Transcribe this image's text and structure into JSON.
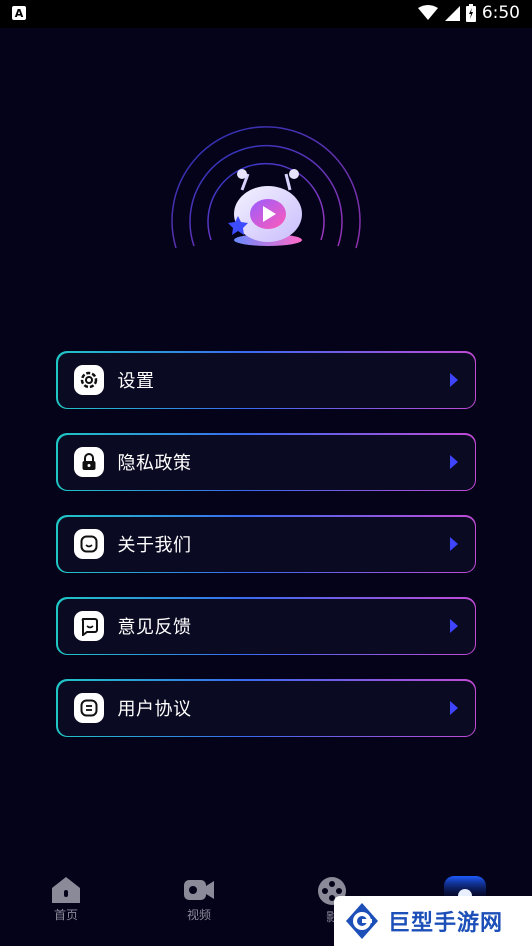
{
  "status_bar": {
    "notification_badge": "A",
    "time": "6:50"
  },
  "hero": {
    "icon": "robot-mascot-play-icon"
  },
  "menu": {
    "items": [
      {
        "label": "设置",
        "icon": "gear-icon"
      },
      {
        "label": "隐私政策",
        "icon": "lock-icon"
      },
      {
        "label": "关于我们",
        "icon": "smile-icon"
      },
      {
        "label": "意见反馈",
        "icon": "chat-smile-icon"
      },
      {
        "label": "用户协议",
        "icon": "document-icon"
      }
    ],
    "arrow_color": "#3f44ff"
  },
  "tab_bar": {
    "tabs": [
      {
        "label": "首页",
        "icon": "home-icon"
      },
      {
        "label": "视频",
        "icon": "video-camera-icon"
      },
      {
        "label": "影",
        "icon": "film-reel-icon"
      },
      {
        "label": "",
        "icon": "profile-icon-active"
      }
    ]
  },
  "watermark": {
    "text": "巨型手游网"
  },
  "colors": {
    "background": "#04031a",
    "border_start": "#1fc7c4",
    "border_mid": "#3a6af0",
    "border_end": "#c24bd6"
  }
}
